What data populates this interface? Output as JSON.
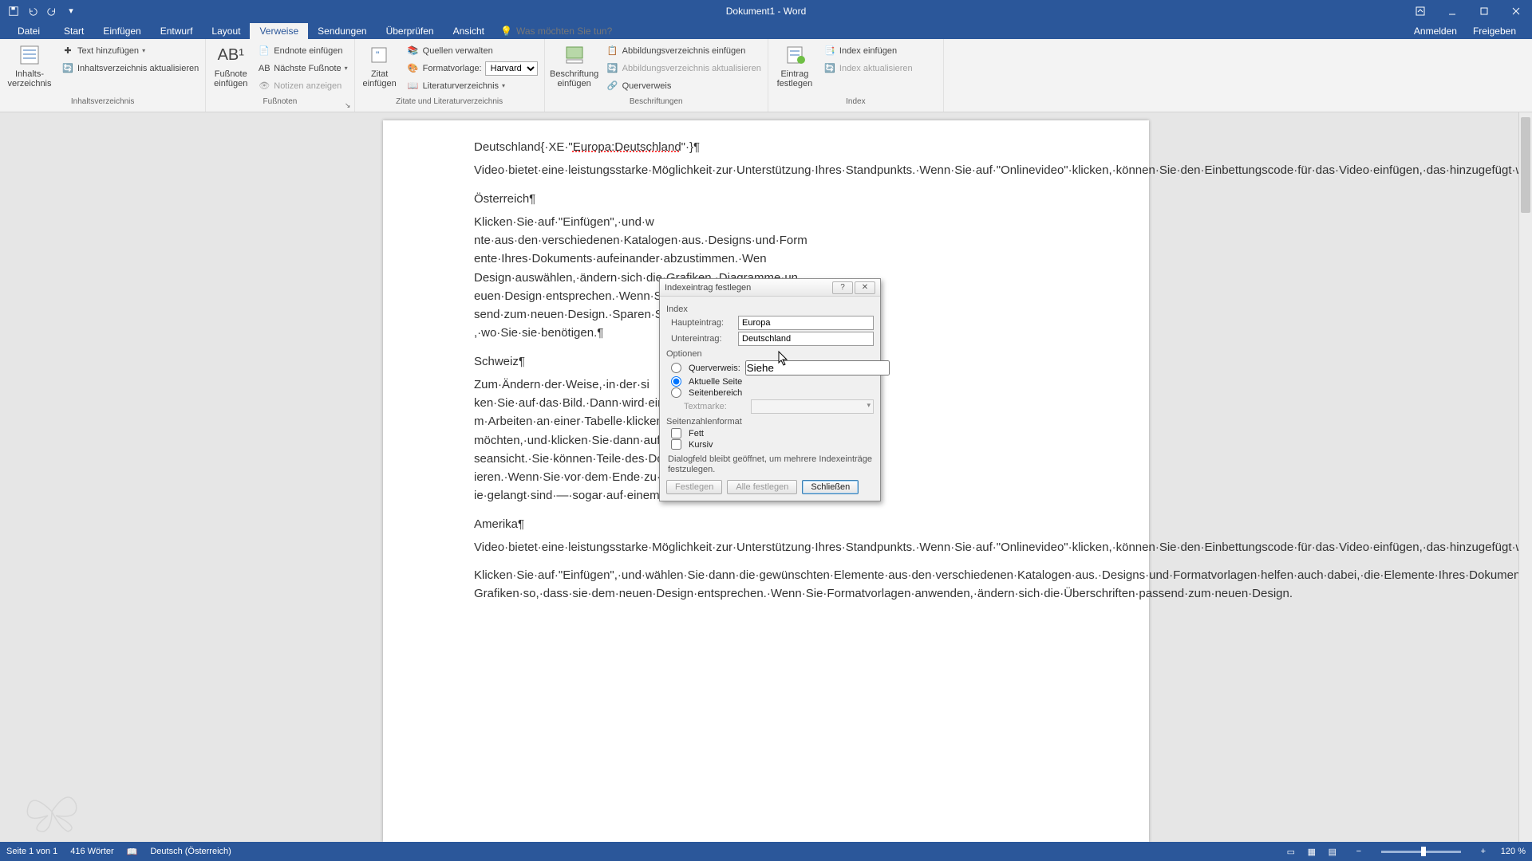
{
  "titlebar": {
    "title": "Dokument1 - Word"
  },
  "tabs": {
    "file": "Datei",
    "items": [
      "Start",
      "Einfügen",
      "Entwurf",
      "Layout",
      "Verweise",
      "Sendungen",
      "Überprüfen",
      "Ansicht"
    ],
    "active_index": 4,
    "tellme": "Was möchten Sie tun?",
    "right": [
      "Anmelden",
      "Freigeben"
    ]
  },
  "ribbon": {
    "toc": {
      "big": "Inhalts-\nverzeichnis",
      "add_text": "Text hinzufügen",
      "update": "Inhaltsverzeichnis aktualisieren",
      "label": "Inhaltsverzeichnis"
    },
    "footnotes": {
      "big": "Fußnote\neinfügen",
      "endnote": "Endnote einfügen",
      "next": "Nächste Fußnote",
      "show": "Notizen anzeigen",
      "label": "Fußnoten"
    },
    "citations": {
      "big": "Zitat\neinfügen",
      "manage": "Quellen verwalten",
      "style_label": "Formatvorlage:",
      "style_value": "Harvard",
      "biblio": "Literaturverzeichnis",
      "label": "Zitate und Literaturverzeichnis"
    },
    "captions": {
      "big": "Beschriftung\neinfügen",
      "insert_tof": "Abbildungsverzeichnis einfügen",
      "update_tof": "Abbildungsverzeichnis aktualisieren",
      "crossref": "Querverweis",
      "label": "Beschriftungen"
    },
    "index": {
      "big": "Eintrag\nfestlegen",
      "insert": "Index einfügen",
      "update": "Index aktualisieren",
      "label": "Index"
    }
  },
  "document": {
    "line1_pre": "Deutschland{·XE·\"",
    "line1_field": "Europa:Deutschland",
    "line1_post": "\"·}¶",
    "p1": "Video·bietet·eine·leistungsstarke·Möglichkeit·zur·Unterstützung·Ihres·Standpunkts.·Wenn·Sie·auf·\"Onlinevideo\"·klicken,·können·Sie·den·Einbettungscode·für·das·Video·einfügen,·das·hinzugefügt·werden·soll.·Sie·können·auch·ein·Stichwort·eingeben,·um·online·nach·dem·Videoclip·zu·suchen,·der·optimal·zu·Ihrem·Dokument·passt.·Damit·Ihr·Dokument·ein·professionelles·Aussehen·erhält,·stellt·Word·einander·ergänzende·Designs·für·Kopfzeile,·Fußzeile,·Deckblatt·und·Textfelder·zur·Verfügung.·Beispielsweise·können·Sie·ein·passendes·Deckblatt·mit·Kopfzeile·und·Randleiste·hinzufügen.¶",
    "h2": "Österreich¶",
    "p2a": "Klicken·Sie·auf·\"Einfügen\",·und·w",
    "p2b": "nte·aus·den·verschiedenen·Katalogen·aus.·Designs·und·Form",
    "p2c": "ente·Ihres·Dokuments·aufeinander·abzustimmen.·Wen",
    "p2d": "Design·auswählen,·ändern·sich·die·Grafiken,·Diagramme·un",
    "p2e": "euen·Design·entsprechen.·Wenn·Sie·Formatvorlagen·anwe",
    "p2f": "send·zum·neuen·Design.·Sparen·Sie·Zeit·in·Word·dank·ne",
    "p2g": ",·wo·Sie·sie·benötigen.¶",
    "h3": "Schweiz¶",
    "p3a": "Zum·Ändern·der·Weise,·in·der·si",
    "p3b": "ken·Sie·auf·das·Bild.·Dann·wird·eine·Schaltfläche·für·Layou",
    "p3c": "m·Arbeiten·an·einer·Tabelle·klicken·Sie·an·die·Position,·an·de",
    "p3d": "möchten,·und·klicken·Sie·dann·auf·das·Pluszeichen.·Auch",
    "p3e": "seansicht.·Sie·können·Teile·des·Dokuments·reduzieren·und·",
    "p3f": "ieren.·Wenn·Sie·vor·dem·Ende·zu·lesen·aufhören·müssen,·",
    "p3g": "ie·gelangt·sind·—·sogar·auf·einem·anderen·Gerät.¶",
    "h4": "Amerika¶",
    "p4": "Video·bietet·eine·leistungsstarke·Möglichkeit·zur·Unterstützung·Ihres·Standpunkts.·Wenn·Sie·auf·\"Onlinevideo\"·klicken,·können·Sie·den·Einbettungscode·für·das·Video·einfügen,·das·hinzugefügt·werden·soll.·Sie·können·auch·ein·Stichwort·eingeben,·um·online·nach·dem·Videoclip·zu·suchen,·der·optimal·zu·Ihrem·Dokument·passt.·Damit·Ihr·Dokument·ein·professionelles·Aussehen·erhält,·stellt·Word·einander·ergänzende·Designs·für·Kopfzeile,·Fußzeile,·Deckblatt·und·Textfelder·zur·Verfügung.·Beispielsweise·können·Sie·ein·passendes·Deckblatt·mit·Kopfzeile·und·Randleiste·hinzufügen.¶",
    "p5": "Klicken·Sie·auf·\"Einfügen\",·und·wählen·Sie·dann·die·gewünschten·Elemente·aus·den·verschiedenen·Katalogen·aus.·Designs·und·Formatvorlagen·helfen·auch·dabei,·die·Elemente·Ihres·Dokuments·aufeinander·abzustimmen.·Wenn·Sie·auf·\"Design\"·klicken·und·ein·neues·Design·auswählen,·ändern·sich·die·Grafiken,·Diagramme·und·SmartArt-Grafiken·so,·dass·sie·dem·neuen·Design·entsprechen.·Wenn·Sie·Formatvorlagen·anwenden,·ändern·sich·die·Überschriften·passend·zum·neuen·Design."
  },
  "dialog": {
    "title": "Indexeintrag festlegen",
    "section_index": "Index",
    "main_label": "Haupteintrag:",
    "main_value": "Europa",
    "sub_label": "Untereintrag:",
    "sub_value": "Deutschland",
    "section_options": "Optionen",
    "crossref_label": "Querverweis:",
    "crossref_value": "Siehe",
    "current_page": "Aktuelle Seite",
    "range": "Seitenbereich",
    "bookmark_label": "Textmarke:",
    "section_format": "Seitenzahlenformat",
    "bold": "Fett",
    "italic": "Kursiv",
    "note": "Dialogfeld bleibt geöffnet, um mehrere Indexeinträge festzulegen.",
    "btn_mark": "Festlegen",
    "btn_mark_all": "Alle festlegen",
    "btn_close": "Schließen"
  },
  "status": {
    "page": "Seite 1 von 1",
    "words": "416 Wörter",
    "lang": "Deutsch (Österreich)",
    "zoom": "120 %"
  }
}
